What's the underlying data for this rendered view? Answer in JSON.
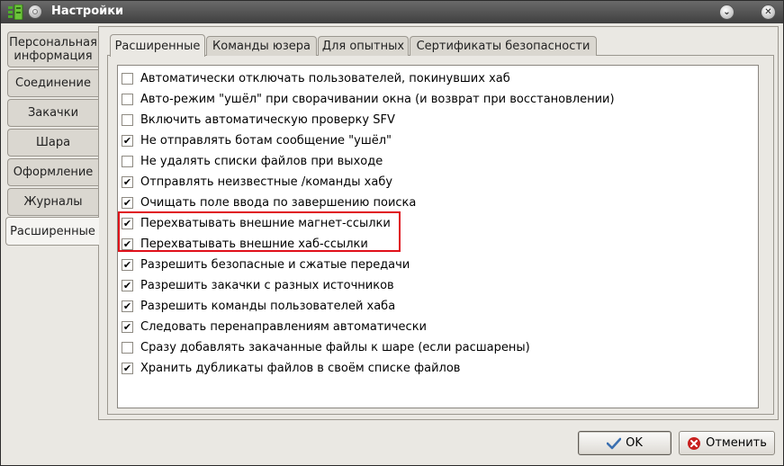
{
  "window": {
    "title": "Настройки"
  },
  "sidebar": {
    "items": [
      {
        "label": "Персональная информация",
        "active": false
      },
      {
        "label": "Соединение",
        "active": false
      },
      {
        "label": "Закачки",
        "active": false
      },
      {
        "label": "Шара",
        "active": false
      },
      {
        "label": "Оформление",
        "active": false
      },
      {
        "label": "Журналы",
        "active": false
      },
      {
        "label": "Расширенные",
        "active": true
      }
    ]
  },
  "tabs": [
    {
      "label": "Расширенные",
      "active": true
    },
    {
      "label": "Команды юзера",
      "active": false
    },
    {
      "label": "Для опытных",
      "active": false
    },
    {
      "label": "Сертификаты безопасности",
      "active": false
    }
  ],
  "options": [
    {
      "label": "Автоматически отключать пользователей, покинувших хаб",
      "checked": false
    },
    {
      "label": "Авто-режим \"ушёл\" при сворачивании окна (и возврат при восстановлении)",
      "checked": false
    },
    {
      "label": "Включить автоматическую проверку SFV",
      "checked": false
    },
    {
      "label": "Не отправлять ботам сообщение \"ушёл\"",
      "checked": true
    },
    {
      "label": "Не удалять списки файлов при выходе",
      "checked": false
    },
    {
      "label": "Отправлять неизвестные /команды хабу",
      "checked": true
    },
    {
      "label": "Очищать поле ввода по завершению поиска",
      "checked": true
    },
    {
      "label": "Перехватывать внешние магнет-ссылки",
      "checked": true
    },
    {
      "label": "Перехватывать внешние хаб-ссылки",
      "checked": true
    },
    {
      "label": "Разрешить безопасные и сжатые передачи",
      "checked": true
    },
    {
      "label": "Разрешить закачки с разных источников",
      "checked": true
    },
    {
      "label": "Разрешить команды пользователей хаба",
      "checked": true
    },
    {
      "label": "Следовать перенаправлениям автоматически",
      "checked": true
    },
    {
      "label": "Сразу добавлять закачанные файлы к шаре (если расшарены)",
      "checked": false
    },
    {
      "label": "Хранить дубликаты файлов в своём списке файлов",
      "checked": true
    }
  ],
  "buttons": {
    "ok_label": "OK",
    "cancel_label": "Отменить"
  },
  "colors": {
    "highlight": "#e0101a",
    "titlebar": "#4a4a4a",
    "ok_icon": "#3a6fb0",
    "cancel_icon": "#c8201e"
  }
}
